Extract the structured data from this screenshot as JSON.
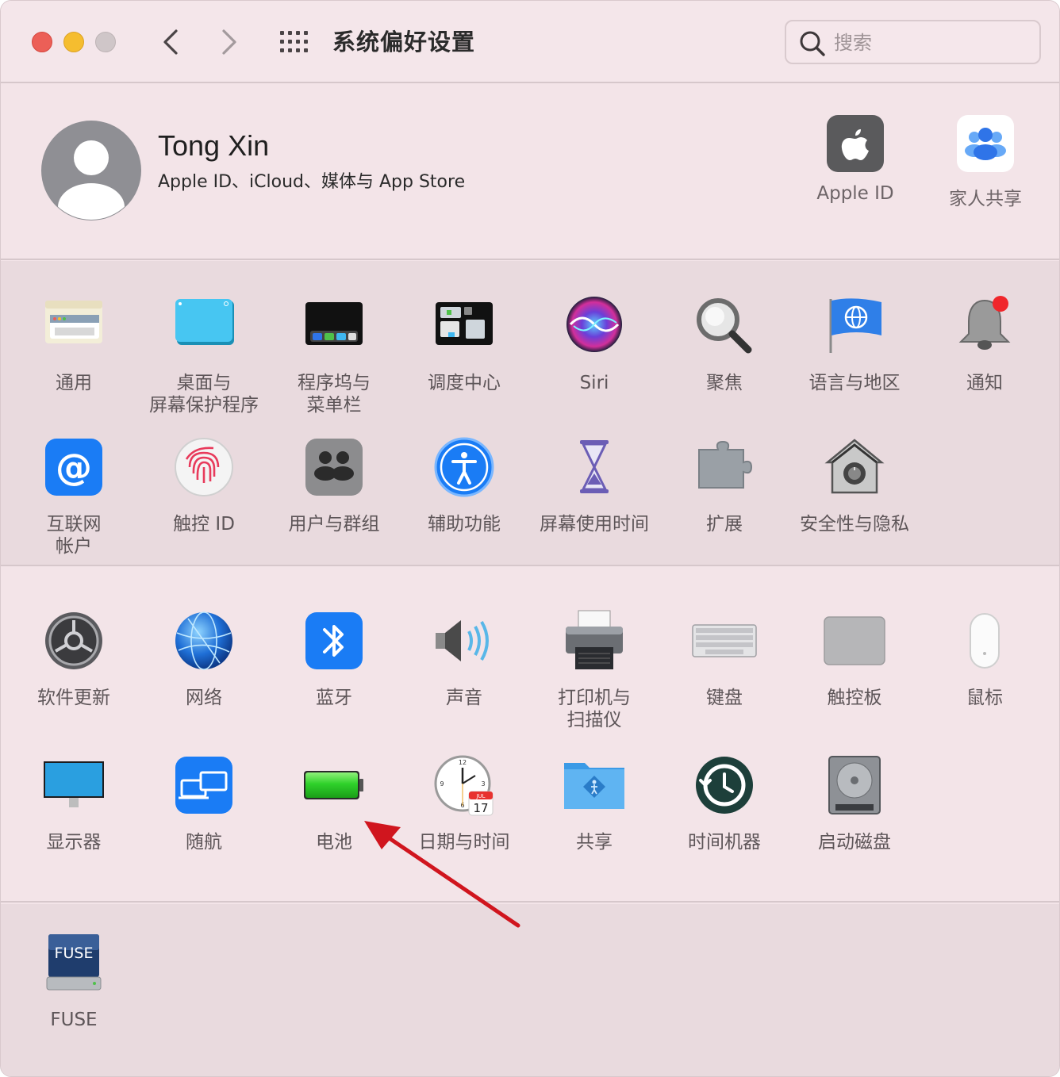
{
  "window": {
    "title": "系统偏好设置",
    "search_placeholder": "搜索"
  },
  "account": {
    "name": "Tong Xin",
    "subtitle": "Apple ID、iCloud、媒体与 App Store",
    "items": [
      {
        "label": "Apple ID",
        "icon": "apple-logo-icon"
      },
      {
        "label": "家人共享",
        "icon": "family-sharing-icon"
      }
    ]
  },
  "sections": [
    {
      "panes": [
        {
          "label": "通用",
          "icon": "general-icon"
        },
        {
          "label": "桌面与\n屏幕保护程序",
          "icon": "desktop-screensaver-icon"
        },
        {
          "label": "程序坞与\n菜单栏",
          "icon": "dock-menubar-icon"
        },
        {
          "label": "调度中心",
          "icon": "mission-control-icon"
        },
        {
          "label": "Siri",
          "icon": "siri-icon"
        },
        {
          "label": "聚焦",
          "icon": "spotlight-icon"
        },
        {
          "label": "语言与地区",
          "icon": "language-region-icon"
        },
        {
          "label": "通知",
          "icon": "notifications-icon"
        },
        {
          "label": "互联网\n帐户",
          "icon": "internet-accounts-icon"
        },
        {
          "label": "触控 ID",
          "icon": "touch-id-icon"
        },
        {
          "label": "用户与群组",
          "icon": "users-groups-icon"
        },
        {
          "label": "辅助功能",
          "icon": "accessibility-icon"
        },
        {
          "label": "屏幕使用时间",
          "icon": "screen-time-icon"
        },
        {
          "label": "扩展",
          "icon": "extensions-icon"
        },
        {
          "label": "安全性与隐私",
          "icon": "security-privacy-icon"
        }
      ]
    },
    {
      "panes": [
        {
          "label": "软件更新",
          "icon": "software-update-icon"
        },
        {
          "label": "网络",
          "icon": "network-icon"
        },
        {
          "label": "蓝牙",
          "icon": "bluetooth-icon"
        },
        {
          "label": "声音",
          "icon": "sound-icon"
        },
        {
          "label": "打印机与\n扫描仪",
          "icon": "printers-scanners-icon"
        },
        {
          "label": "键盘",
          "icon": "keyboard-icon"
        },
        {
          "label": "触控板",
          "icon": "trackpad-icon"
        },
        {
          "label": "鼠标",
          "icon": "mouse-icon"
        },
        {
          "label": "显示器",
          "icon": "displays-icon"
        },
        {
          "label": "随航",
          "icon": "sidecar-icon"
        },
        {
          "label": "电池",
          "icon": "battery-icon"
        },
        {
          "label": "日期与时间",
          "icon": "date-time-icon"
        },
        {
          "label": "共享",
          "icon": "sharing-icon"
        },
        {
          "label": "时间机器",
          "icon": "time-machine-icon"
        },
        {
          "label": "启动磁盘",
          "icon": "startup-disk-icon"
        }
      ]
    },
    {
      "panes": [
        {
          "label": "FUSE",
          "icon": "fuse-icon"
        }
      ]
    }
  ],
  "icon_text": {
    "fuse": "FUSE",
    "calendar_month": "JUL",
    "calendar_day": "17"
  },
  "colors": {
    "accent_blue": "#1a7cf5",
    "annotation_arrow": "#d0151e",
    "battery_green": "#2fd12a"
  }
}
